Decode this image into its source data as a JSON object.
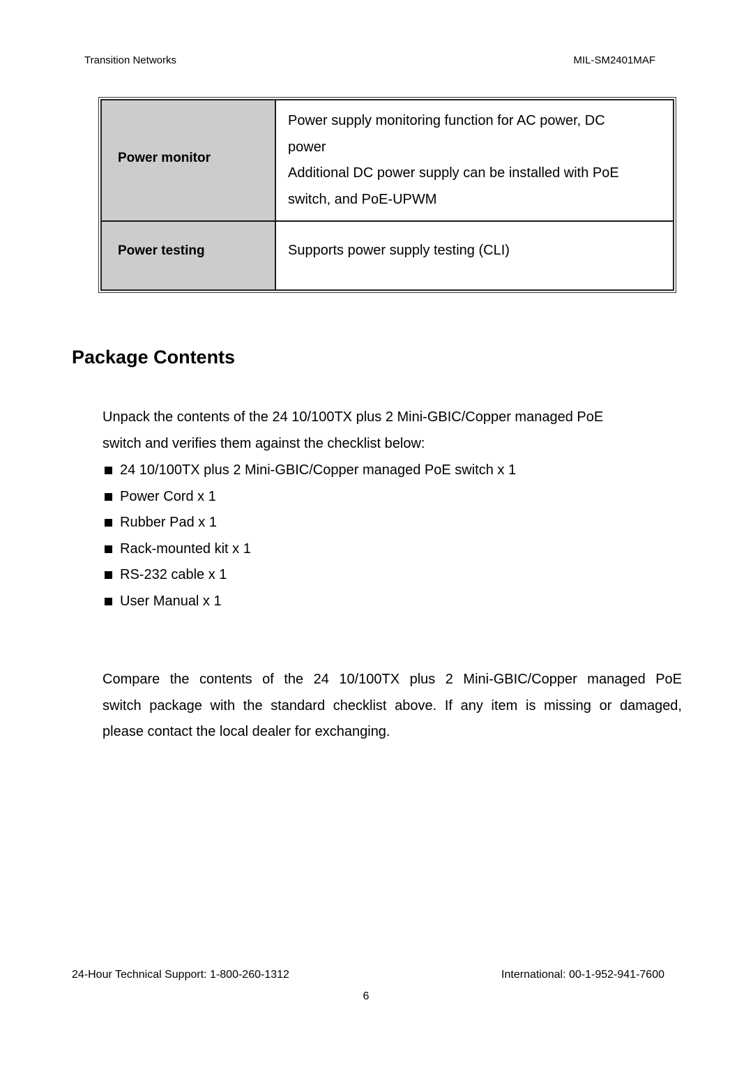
{
  "header": {
    "company": "Transition Networks",
    "model": "MIL-SM2401MAF"
  },
  "spec_table": {
    "rows": [
      {
        "key": "Power monitor",
        "value_lines": [
          "Power supply monitoring function for AC power, DC",
          "power",
          "Additional DC power supply can be installed with PoE",
          "switch, and PoE-UPWM"
        ]
      },
      {
        "key": "Power testing",
        "value_lines": [
          "Supports power supply testing (CLI)"
        ]
      }
    ],
    "key_cell_color": "#cccccc"
  },
  "section": {
    "title": "Package Contents",
    "intro_lines": [
      "Unpack the contents of the 24 10/100TX plus 2 Mini-GBIC/Copper managed PoE",
      "switch and verifies them against the checklist below:"
    ],
    "checklist": [
      "24 10/100TX plus 2 Mini-GBIC/Copper managed PoE switch x 1",
      "Power Cord x 1",
      "Rubber Pad x 1",
      "Rack-mounted kit x 1",
      "RS-232 cable x 1",
      "User Manual x 1"
    ],
    "bullet_icon": "black-square",
    "outro_lines": [
      "Compare the contents of the 24 10/100TX plus 2 Mini-GBIC/Copper managed PoE",
      "switch package with the standard checklist above. If any item is missing or damaged,",
      "please contact the local dealer for exchanging."
    ]
  },
  "footer": {
    "support": "24-Hour Technical Support: 1-800-260-1312",
    "international": "International: 00-1-952-941-7600",
    "page_number": "6"
  }
}
